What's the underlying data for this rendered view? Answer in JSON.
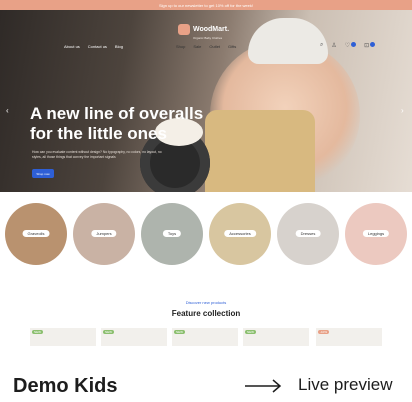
{
  "promo": {
    "text": "Sign up to our newsletter to get 10% off for the week!"
  },
  "header": {
    "logo": "WoodMart.",
    "tagline": "Organic Baby Clothes",
    "nav_left": [
      "About us",
      "Contact us",
      "Blog"
    ],
    "nav_main": [
      "Shop",
      "Sale",
      "Outlet",
      "Gifts"
    ],
    "icons": [
      "search-icon",
      "user-icon",
      "heart-icon",
      "cart-icon"
    ],
    "wishlist_count": "0",
    "cart_count": "0"
  },
  "hero": {
    "title": "A new line of overalls for the little ones",
    "description": "How can you evaluate content without design? No typography, no colors, no layout, no styles, all those things that convey the important signals",
    "button": "Shop now",
    "prev": "‹",
    "next": "›"
  },
  "categories": [
    {
      "label": "Graveolls",
      "color": "#b9926f"
    },
    {
      "label": "Jumpers",
      "color": "#c9b2a4"
    },
    {
      "label": "Toys",
      "color": "#aeb4ad"
    },
    {
      "label": "Accessories",
      "color": "#d8c6a0"
    },
    {
      "label": "Dresses",
      "color": "#d7d2cd"
    },
    {
      "label": "Leggings",
      "color": "#ecc9c0"
    }
  ],
  "section": {
    "kicker": "Discover new products",
    "title": "Feature collection"
  },
  "products": [
    {
      "tag": "NEW",
      "sale": false
    },
    {
      "tag": "NEW",
      "sale": false
    },
    {
      "tag": "NEW",
      "sale": false
    },
    {
      "tag": "NEW",
      "sale": false
    },
    {
      "tag": "-10%",
      "sale": true
    }
  ],
  "footer": {
    "title": "Demo Kids",
    "link": "Live preview"
  },
  "colors": {
    "accent": "#2e5fd6",
    "promo": "#e8a187"
  }
}
